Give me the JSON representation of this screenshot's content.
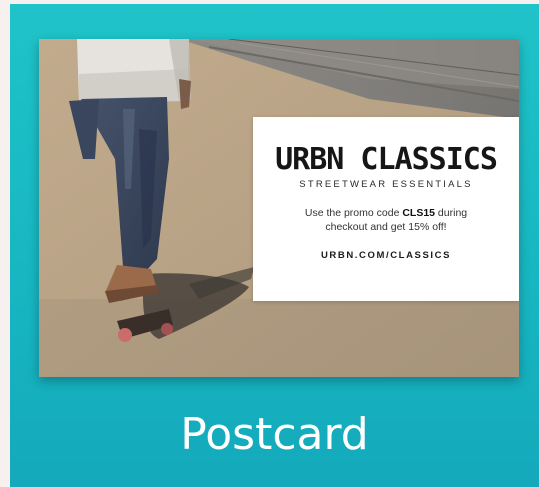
{
  "card": {
    "label": "Postcard",
    "brand": "URBN CLASSICS",
    "tagline": "STREETWEAR ESSENTIALS",
    "promo_prefix": "Use the promo code ",
    "promo_code": "CLS15",
    "promo_suffix": " during checkout and get 15% off!",
    "website": "URBN.COM/CLASSICS"
  },
  "colors": {
    "tile_background": "#1fc3c8",
    "page_background": "#f6f1ef",
    "overlay_background": "#ffffff",
    "label_color": "#ffffff"
  }
}
